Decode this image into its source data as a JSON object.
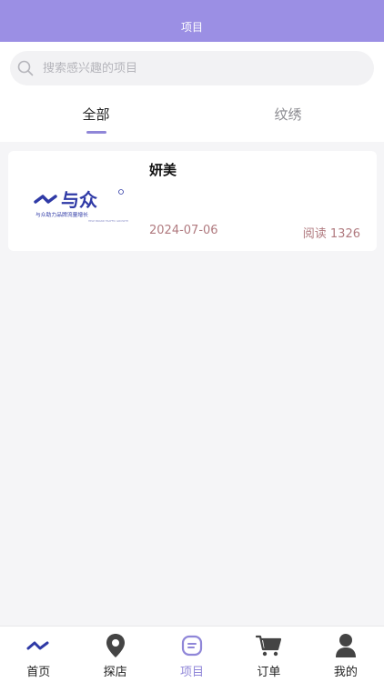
{
  "header": {
    "title": "项目"
  },
  "search": {
    "placeholder": "搜索感兴趣的项目",
    "icon": "search-icon"
  },
  "tabs": [
    {
      "label": "全部",
      "active": true
    },
    {
      "label": "纹绣",
      "active": false
    }
  ],
  "projects": [
    {
      "title": "妍美",
      "date": "2024-07-06",
      "reads": "阅读 1326",
      "logo": {
        "brand": "与众",
        "tagline": "与众助力品牌流量增长",
        "tagline_en": "HELP BRAND TRAFFIC GROWTH"
      }
    }
  ],
  "bottom_nav": [
    {
      "label": "首页",
      "icon": "home-logo-icon",
      "active": false
    },
    {
      "label": "探店",
      "icon": "location-pin-icon",
      "active": false
    },
    {
      "label": "项目",
      "icon": "project-icon",
      "active": true
    },
    {
      "label": "订单",
      "icon": "cart-icon",
      "active": false
    },
    {
      "label": "我的",
      "icon": "user-icon",
      "active": false
    }
  ],
  "colors": {
    "accent": "#9b8fe4",
    "active_tab": "#8f86d8",
    "meta_text": "#b07a7f",
    "brand_blue": "#2f3aa6"
  }
}
